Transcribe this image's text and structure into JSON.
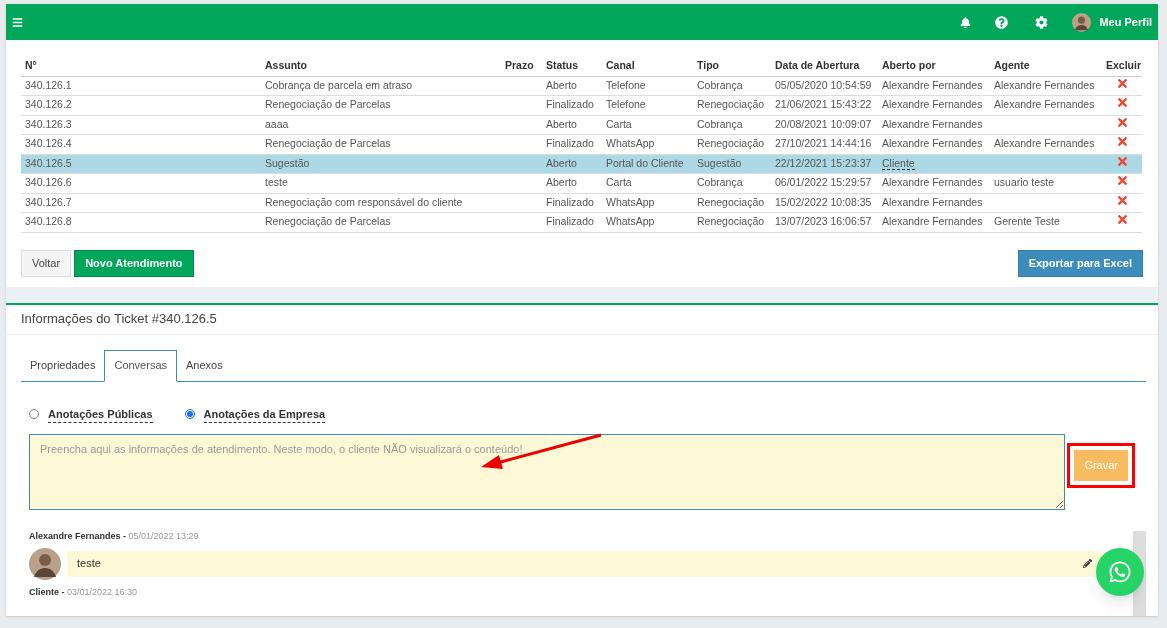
{
  "topbar": {
    "profile_label": "Meu Perfil"
  },
  "table": {
    "columns": [
      "N°",
      "Assunto",
      "Prazo",
      "Status",
      "Canal",
      "Tipo",
      "Data de Abertura",
      "Aberto por",
      "Agente",
      "Excluir"
    ],
    "rows": [
      {
        "number": "340.126.1",
        "subject": "Cobrança de parcela em atraso",
        "status": "Aberto",
        "channel": "Telefone",
        "type": "Cobrança",
        "opened_at": "05/05/2020 10:54:59",
        "opened_by": "Alexandre Fernandes",
        "opened_by_link": false,
        "agent": "Alexandre Fernandes",
        "selected": false
      },
      {
        "number": "340.126.2",
        "subject": "Renegociação de Parcelas",
        "status": "Finalizado",
        "channel": "Telefone",
        "type": "Renegociação",
        "opened_at": "21/06/2021 15:43:22",
        "opened_by": "Alexandre Fernandes",
        "opened_by_link": false,
        "agent": "Alexandre Fernandes",
        "selected": false
      },
      {
        "number": "340.126.3",
        "subject": "aaaa",
        "status": "Aberto",
        "channel": "Carta",
        "type": "Cobrança",
        "opened_at": "20/08/2021 10:09:07",
        "opened_by": "Alexandre Fernandes",
        "opened_by_link": false,
        "selected": false
      },
      {
        "number": "340.126.4",
        "subject": "Renegociação de Parcelas",
        "status": "Finalizado",
        "channel": "WhatsApp",
        "type": "Renegociação",
        "opened_at": "27/10/2021 14:44:16",
        "opened_by": "Alexandre Fernandes",
        "opened_by_link": false,
        "agent": "Alexandre Fernandes",
        "selected": false
      },
      {
        "number": "340.126.5",
        "subject": "Sugestão",
        "status": "Aberto",
        "channel": "Portal do Cliente",
        "type": "Sugestão",
        "opened_at": "22/12/2021 15:23:37",
        "opened_by": "Cliente",
        "opened_by_link": true,
        "selected": true
      },
      {
        "number": "340.126.6",
        "subject": "teste",
        "status": "Aberto",
        "channel": "Carta",
        "type": "Cobrança",
        "opened_at": "06/01/2022 15:29:57",
        "opened_by": "Alexandre Fernandes",
        "opened_by_link": false,
        "agent": "usuario teste",
        "selected": false
      },
      {
        "number": "340.126.7",
        "subject": "Renegociação com responsável do cliente",
        "status": "Finalizado",
        "channel": "WhatsApp",
        "type": "Renegociação",
        "opened_at": "15/02/2022 10:08:35",
        "opened_by": "Alexandre Fernandes",
        "opened_by_link": false,
        "selected": false
      },
      {
        "number": "340.126.8",
        "subject": "Renegociação de Parcelas",
        "status": "Finalizado",
        "channel": "WhatsApp",
        "type": "Renegociação",
        "opened_at": "13/07/2023 16:06:57",
        "opened_by": "Alexandre Fernandes",
        "opened_by_link": false,
        "agent": "Gerente Teste",
        "selected": false
      }
    ]
  },
  "actions": {
    "back": "Voltar",
    "new": "Novo Atendimento",
    "export": "Exportar para Excel"
  },
  "ticket": {
    "title": "Informações do Ticket #340.126.5",
    "tabs": [
      {
        "label": "Propriedades",
        "selected": false
      },
      {
        "label": "Conversas",
        "selected": true
      },
      {
        "label": "Anexos",
        "selected": false
      }
    ],
    "note_types": [
      {
        "label": "Anotações Públicas",
        "selected": false
      },
      {
        "label": "Anotações da Empresa",
        "selected": true
      }
    ],
    "note_field": {
      "placeholder": "Preencha aqui as informações de atendimento. Neste modo, o cliente NÃO visualizará o conteúdo!"
    },
    "save": "Gravar",
    "comments": [
      {
        "author": "Alexandre Fernandes -",
        "time": "05/01/2022 13:29",
        "text": "teste"
      },
      {
        "author": "Cliente -",
        "time": "03/01/2022 16:30"
      }
    ]
  }
}
